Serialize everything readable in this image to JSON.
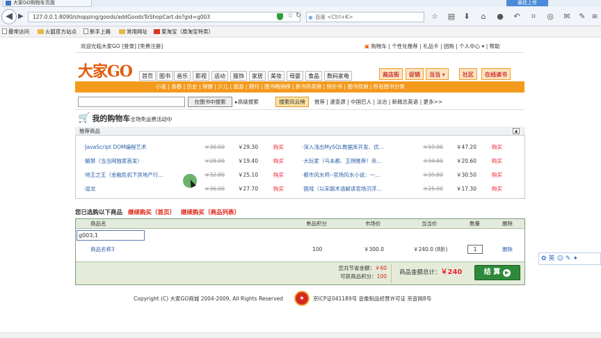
{
  "browser": {
    "tab_title": "大家GO购物车页面",
    "side_button": "悬挂上传",
    "url": "127.0.0.1:8090/shopping/goods/addGoodsToShopCart.do?gid=g003",
    "search_placeholder": "百度 <Ctrl+K>",
    "bookmarks": [
      "最常访问",
      "火狐官方站点",
      "新手上路",
      "常用网址",
      "爱淘宝（原淘宝特卖）"
    ]
  },
  "site": {
    "welcome": "欢迎光临大家GO [登录] [免费注册]",
    "top_links": "购物车 | 个性化推荐 | 礼品卡 | 团购 | 个人中心 ▾ | 帮助",
    "logo": "大家GO",
    "nav": [
      "首页",
      "图书",
      "音乐",
      "影视",
      "运动",
      "服饰",
      "家居",
      "美妆",
      "母婴",
      "食品",
      "数码家电"
    ],
    "nav_right": [
      "商店街",
      "促销",
      "当当",
      "社区",
      "在线读书"
    ],
    "sub_nav": "小说 | 青春 | 历史 | 保健 | 少儿 | 旅游 | 期刊 | 图书畅销榜 | 新书热卖榜 | 特价书 | 图书促销 | 所有图书分类",
    "search_button": "在图书中搜索",
    "advanced": "▸高级搜索",
    "hot_button": "搜索风云榜",
    "hot_links": "推荐 | 速查源 | 中国巴人 | 法治 | 新概念英语 | 更多>>"
  },
  "cart": {
    "title": "我的购物车",
    "subtitle": "全场免运费活动中",
    "recommend_header": "推荐商品",
    "recommend_left": [
      {
        "name": "·JavaScript DOM编程艺术",
        "old": "￥30.00",
        "price": "￥29.30",
        "buy": "购买"
      },
      {
        "name": "·解禁（当当网独家首发）",
        "old": "￥28.00",
        "price": "￥19.40",
        "buy": "购买"
      },
      {
        "name": "·地王之王（金融危机下房地产行...",
        "old": "￥32.80",
        "price": "￥25.10",
        "buy": "购买"
      },
      {
        "name": "·逗龙",
        "old": "￥36.00",
        "price": "￥27.70",
        "buy": "购买"
      }
    ],
    "recommend_right": [
      {
        "name": "·深入浅出MySQL数据库开发、优...",
        "old": "￥59.00",
        "price": "￥47.20",
        "buy": "购买"
      },
      {
        "name": "·大玩家（马未都、王朔推荐！央...",
        "old": "￥34.80",
        "price": "￥20.60",
        "buy": "购买"
      },
      {
        "name": "·都市风水师--官场风水小说：一...",
        "old": "￥39.80",
        "price": "￥30.50",
        "buy": "购买"
      },
      {
        "name": "·国戏（以宋朝术语解读官场沉浮...",
        "old": "￥25.00",
        "price": "￥17.30",
        "buy": "购买"
      }
    ],
    "selected_label": "您已选购以下商品",
    "continue_home": "继续购买（首页）",
    "continue_list": "继续购买（商品列表）",
    "headers": {
      "name": "商品名",
      "points": "单品积分",
      "market": "市场价",
      "current": "当当价",
      "qty": "数量",
      "delete": "删除"
    },
    "debug_input": "g003,1",
    "item": {
      "name": "商品名称3",
      "points": "100",
      "market": "￥300.0",
      "current": "￥240.0 (8折)",
      "qty": "1",
      "delete": "删除"
    },
    "saved_label": "您共节省金额：",
    "saved_value": "￥60",
    "points_label": "可获商品积分：",
    "points_value": "100",
    "total_label": "商品金额总计：",
    "total_value": "￥240",
    "checkout": "结 算"
  },
  "footer": {
    "copyright": "Copyright (C) 大家GO商城 2004-2009, All Rights Reserved",
    "icp": "京ICP证041189号 音像制品经营许可证 京音网8号"
  },
  "ime": "英"
}
